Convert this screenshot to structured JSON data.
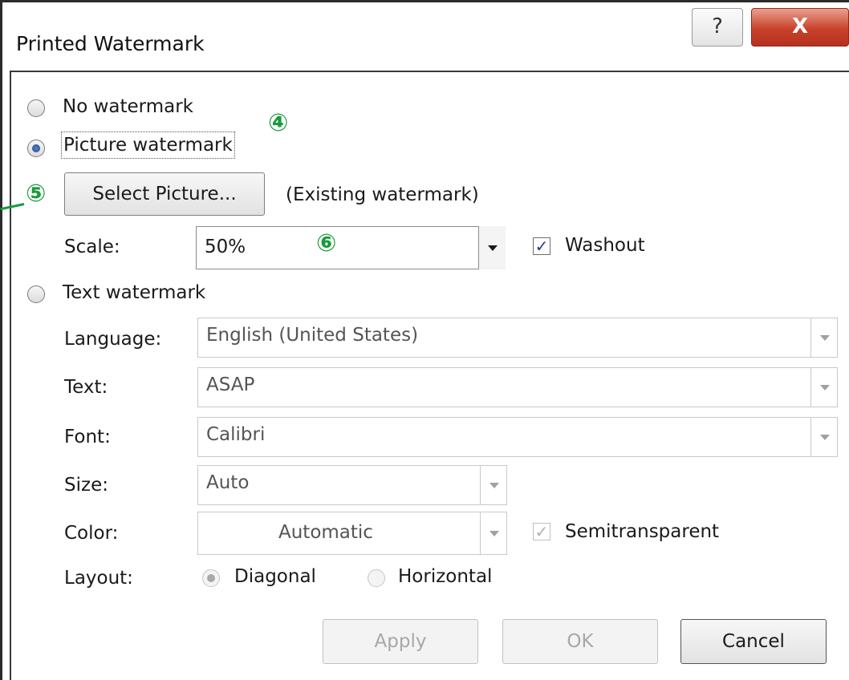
{
  "window": {
    "title": "Printed Watermark",
    "help_label": "?",
    "close_label": "X"
  },
  "options": {
    "no_watermark": {
      "label": "No watermark",
      "selected": false
    },
    "picture_watermark": {
      "label": "Picture watermark",
      "selected": true
    },
    "text_watermark": {
      "label": "Text watermark",
      "selected": false
    }
  },
  "picture": {
    "select_button": "Select Picture...",
    "existing": "(Existing watermark)",
    "scale_label": "Scale:",
    "scale_value": "50%",
    "washout_label": "Washout",
    "washout_checked": true
  },
  "text_wm": {
    "language_label": "Language:",
    "language_value": "English (United States)",
    "text_label": "Text:",
    "text_value": "ASAP",
    "font_label": "Font:",
    "font_value": "Calibri",
    "size_label": "Size:",
    "size_value": "Auto",
    "color_label": "Color:",
    "color_value": "Automatic",
    "semitransparent_label": "Semitransparent",
    "semitransparent_checked": true,
    "layout_label": "Layout:",
    "layout_diagonal": "Diagonal",
    "layout_horizontal": "Horizontal",
    "layout_selected": "Diagonal"
  },
  "buttons": {
    "apply": "Apply",
    "ok": "OK",
    "cancel": "Cancel"
  },
  "callouts": {
    "c4": "④",
    "c5": "⑤",
    "c6": "⑥"
  },
  "colors": {
    "callout": "#1a9a3e",
    "close": "#c8412a",
    "accent": "#1e3d8f"
  }
}
